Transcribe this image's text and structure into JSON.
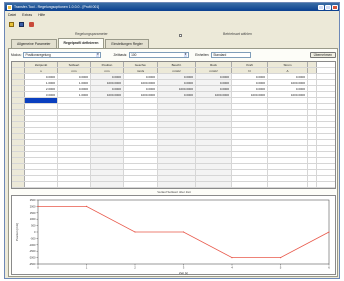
{
  "window": {
    "title": "Transfer-Tool - Regelungsoptionen 1.0.0.0 - [Profil 001]",
    "colors": {
      "titlebar": "#0a3f8f",
      "selection": "#0a3fbf",
      "curve": "#e8584a"
    }
  },
  "menu": [
    "Datei",
    "Extras",
    "Hilfe"
  ],
  "toolbar": {
    "buttons": [
      {
        "name": "open-folder-icon"
      },
      {
        "name": "save-icon"
      },
      {
        "name": "settings-tool-icon"
      }
    ]
  },
  "sections": {
    "left_label": "Regelungsparameter",
    "right_label": "Betriebsart wählen"
  },
  "tabs": [
    {
      "label": "Allgemeine Parameter",
      "active": false
    },
    {
      "label": "Regelprofil definieren",
      "active": true
    },
    {
      "label": "Einstellungen Regler",
      "active": false
    }
  ],
  "options": {
    "mode_label": "Modus:",
    "mode_value": "Positionsregelung",
    "timebase_label": "Zeitbasis:",
    "timebase_value": "100",
    "units_label": "Einheiten:",
    "units_value": "Standard",
    "apply_label": "Übernehmen"
  },
  "table": {
    "headers": [
      "Zeitpunkt",
      "Sollwert",
      "Position",
      "Geschw.",
      "Beschl.",
      "Ruck",
      "Kraft",
      "Strom"
    ],
    "units": [
      "s",
      "mm",
      "mm",
      "mm/s",
      "mm/s²",
      "mm/s³",
      "N",
      "A"
    ],
    "rows": [
      [
        "0.0000",
        "0.0000",
        "0.0000",
        "0.0000",
        "0.0000",
        "0.0000",
        "0.0000",
        "0.0000"
      ],
      [
        "1.0000",
        "1.0000",
        "1000.0000",
        "1000.0000",
        "0.0000",
        "0.0000",
        "0.0000",
        "1000.0000"
      ],
      [
        "2.0000",
        "0.0000",
        "0.0000",
        "0.0000",
        "1000.0000",
        "0.0000",
        "0.0000",
        "0.0000"
      ],
      [
        "3.0000",
        "1.0000",
        "1000.0000",
        "1000.0000",
        "0.0000",
        "1000.0000",
        "1000.0000",
        "1000.0000"
      ],
      [
        "",
        "",
        "",
        "",
        "",
        "",
        "",
        ""
      ],
      [
        "",
        "",
        "",
        "",
        "",
        "",
        "",
        ""
      ],
      [
        "",
        "",
        "",
        "",
        "",
        "",
        "",
        ""
      ],
      [
        "",
        "",
        "",
        "",
        "",
        "",
        "",
        ""
      ],
      [
        "",
        "",
        "",
        "",
        "",
        "",
        "",
        ""
      ],
      [
        "",
        "",
        "",
        "",
        "",
        "",
        "",
        ""
      ],
      [
        "",
        "",
        "",
        "",
        "",
        "",
        "",
        ""
      ],
      [
        "",
        "",
        "",
        "",
        "",
        "",
        "",
        ""
      ],
      [
        "",
        "",
        "",
        "",
        "",
        "",
        "",
        ""
      ],
      [
        "",
        "",
        "",
        "",
        "",
        "",
        "",
        ""
      ],
      [
        "",
        "",
        "",
        "",
        "",
        "",
        "",
        ""
      ],
      [
        "",
        "",
        "",
        "",
        "",
        "",
        "",
        ""
      ],
      [
        "",
        "",
        "",
        "",
        "",
        "",
        "",
        ""
      ],
      [
        "",
        "",
        "",
        "",
        "",
        "",
        "",
        ""
      ],
      [
        "",
        "",
        "",
        "",
        "",
        "",
        "",
        ""
      ],
      [
        "",
        "",
        "",
        "",
        "",
        "",
        "",
        ""
      ]
    ],
    "selected_row": 4
  },
  "chart": {
    "title": "Verlauf Sollwert über Zeit",
    "xlabel": "Zeit [s]",
    "ylabel": "Position [mm]"
  },
  "chart_data": {
    "type": "line",
    "title": "Verlauf Sollwert über Zeit",
    "xlabel": "Zeit [s]",
    "ylabel": "Position [mm]",
    "x": [
      0,
      1,
      2,
      3,
      4,
      5,
      6
    ],
    "series": [
      {
        "values": [
          2000,
          2000,
          0,
          0,
          -2000,
          -2000,
          0
        ]
      }
    ],
    "xlim": [
      0,
      6
    ],
    "ylim": [
      -2500,
      2500
    ],
    "xticks": [
      0,
      1,
      2,
      3,
      4,
      5,
      6
    ],
    "yticks": [
      2500,
      2000,
      1500,
      1000,
      500,
      0,
      -500,
      -1000,
      -1500,
      -2000,
      -2500
    ],
    "grid": false
  }
}
